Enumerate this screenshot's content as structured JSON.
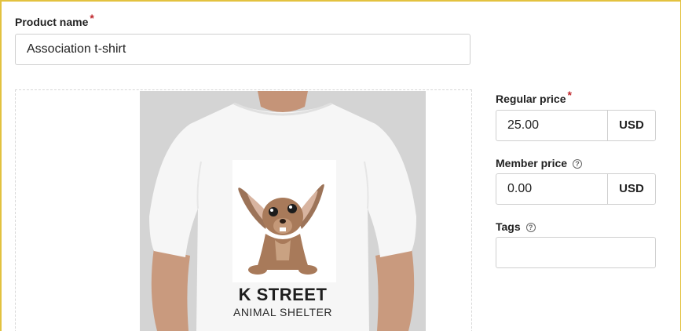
{
  "product_name": {
    "label": "Product name",
    "required_mark": "*",
    "value": "Association t-shirt"
  },
  "regular_price": {
    "label": "Regular price",
    "required_mark": "*",
    "value": "25.00",
    "currency": "USD"
  },
  "member_price": {
    "label": "Member price",
    "help_icon": "?",
    "value": "0.00",
    "currency": "USD"
  },
  "tags": {
    "label": "Tags",
    "help_icon": "?",
    "value": ""
  },
  "image": {
    "icon": "product-photo",
    "shirt_line1": "K STREET",
    "shirt_line2": "ANIMAL SHELTER"
  },
  "colors": {
    "frame": "#e3c23f",
    "required": "#c0282d",
    "border": "#cfcfcf",
    "photo_bg": "#d4d4d4"
  }
}
